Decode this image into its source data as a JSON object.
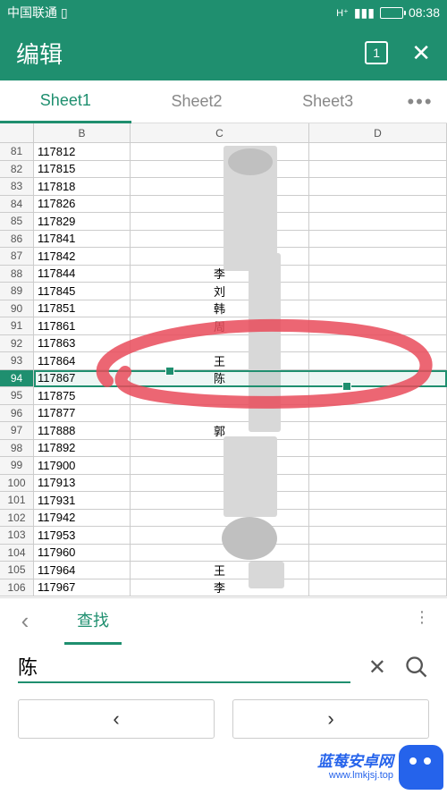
{
  "status": {
    "carrier": "中国联通",
    "time": "08:38"
  },
  "appbar": {
    "title": "编辑",
    "tab_badge": "1"
  },
  "tabs": {
    "items": [
      "Sheet1",
      "Sheet2",
      "Sheet3"
    ],
    "active": 0
  },
  "columns": [
    "B",
    "C",
    "D"
  ],
  "rows": [
    {
      "n": "81",
      "b": "117812",
      "c": ""
    },
    {
      "n": "82",
      "b": "117815",
      "c": ""
    },
    {
      "n": "83",
      "b": "117818",
      "c": ""
    },
    {
      "n": "84",
      "b": "117826",
      "c": ""
    },
    {
      "n": "85",
      "b": "117829",
      "c": ""
    },
    {
      "n": "86",
      "b": "117841",
      "c": ""
    },
    {
      "n": "87",
      "b": "117842",
      "c": ""
    },
    {
      "n": "88",
      "b": "117844",
      "c": "李"
    },
    {
      "n": "89",
      "b": "117845",
      "c": "刘"
    },
    {
      "n": "90",
      "b": "117851",
      "c": "韩"
    },
    {
      "n": "91",
      "b": "117861",
      "c": "周"
    },
    {
      "n": "92",
      "b": "117863",
      "c": ""
    },
    {
      "n": "93",
      "b": "117864",
      "c": "王"
    },
    {
      "n": "94",
      "b": "117867",
      "c": "陈"
    },
    {
      "n": "95",
      "b": "117875",
      "c": ""
    },
    {
      "n": "96",
      "b": "117877",
      "c": ""
    },
    {
      "n": "97",
      "b": "117888",
      "c": "郭"
    },
    {
      "n": "98",
      "b": "117892",
      "c": ""
    },
    {
      "n": "99",
      "b": "117900",
      "c": ""
    },
    {
      "n": "100",
      "b": "117913",
      "c": ""
    },
    {
      "n": "101",
      "b": "117931",
      "c": ""
    },
    {
      "n": "102",
      "b": "117942",
      "c": ""
    },
    {
      "n": "103",
      "b": "117953",
      "c": ""
    },
    {
      "n": "104",
      "b": "117960",
      "c": ""
    },
    {
      "n": "105",
      "b": "117964",
      "c": "王"
    },
    {
      "n": "106",
      "b": "117967",
      "c": "李"
    }
  ],
  "selected_row_index": 13,
  "findbar": {
    "label": "查找"
  },
  "search": {
    "value": "陈"
  },
  "watermark": {
    "brand": "蓝莓安卓网",
    "url": "www.lmkjsj.top"
  },
  "colors": {
    "primary": "#1f8f6f",
    "annotation": "#e94b5a"
  }
}
